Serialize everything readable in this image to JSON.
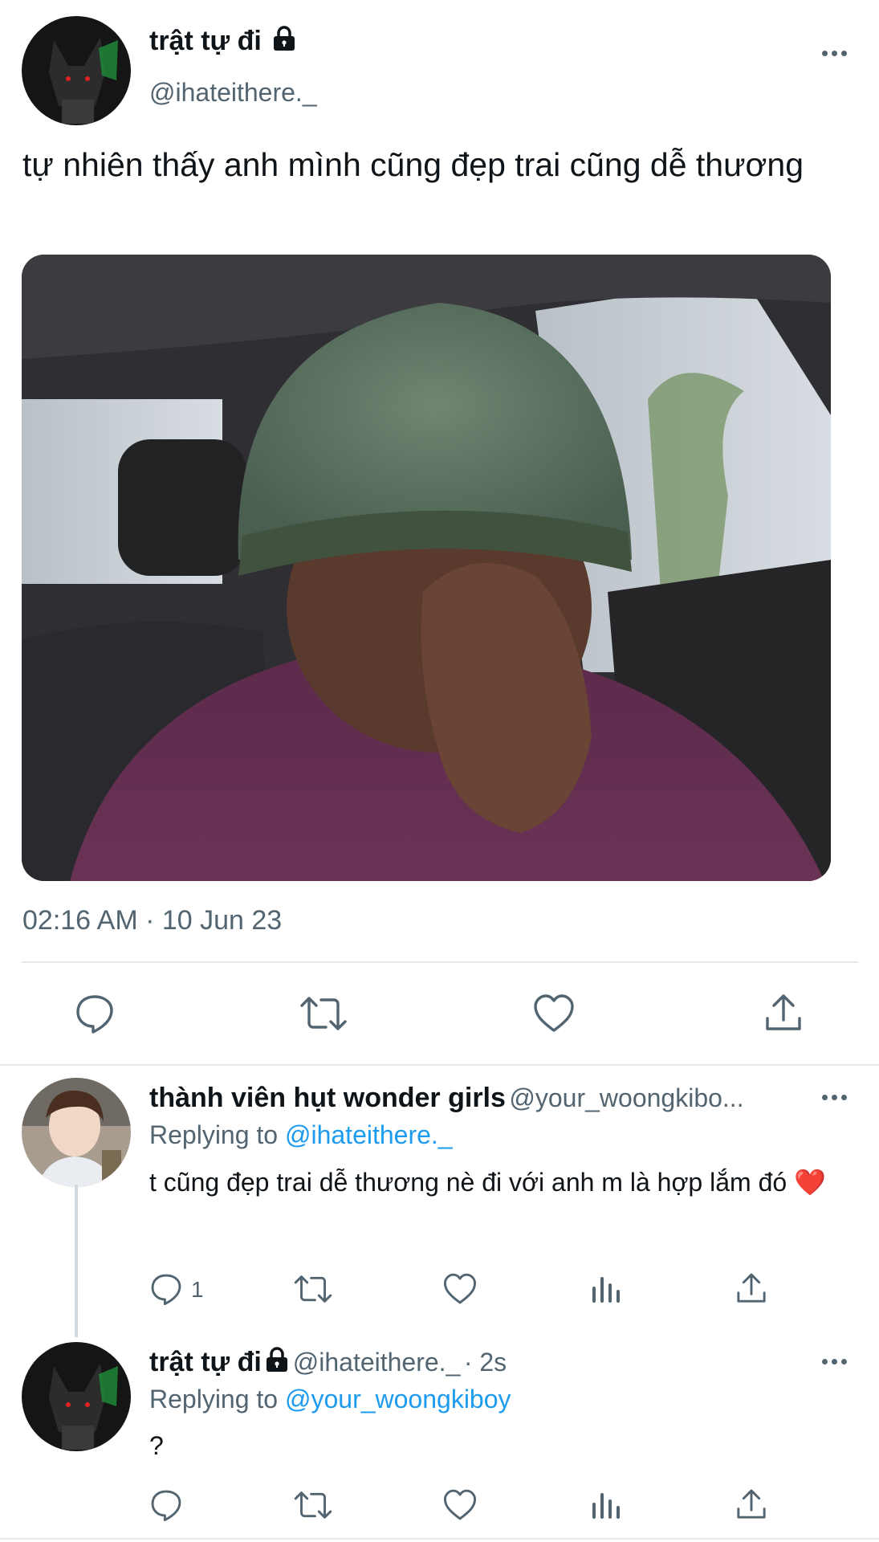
{
  "main_tweet": {
    "display_name": "trật tự đi",
    "handle": "@ihateithere._",
    "text": "tự nhiên thấy anh mình cũng đẹp trai cũng dễ thương",
    "timestamp": "02:16 AM · 10 Jun 23",
    "icons": [
      "lock-icon",
      "more-icon",
      "reply-icon",
      "retweet-icon",
      "like-icon",
      "share-icon"
    ]
  },
  "replies": [
    {
      "display_name": "thành viên hụt wonder girls",
      "handle": "@your_woongkibo...",
      "replying_prefix": "Replying to",
      "replying_to": "@ihateithere._",
      "text": "t cũng đẹp trai dễ thương nè đi với anh m là hợp lắm đó",
      "emoji": "❤️",
      "reply_count": "1"
    },
    {
      "display_name": "trật tự đi",
      "handle": "@ihateithere._",
      "time": "· 2s",
      "replying_prefix": "Replying to",
      "replying_to": "@your_woongkiboy",
      "text": "?"
    }
  ],
  "colors": {
    "text": "#0f1419",
    "secondary": "#536471",
    "link": "#1d9bf0",
    "divider": "#e6e9eb",
    "heart": "#e0245e"
  }
}
